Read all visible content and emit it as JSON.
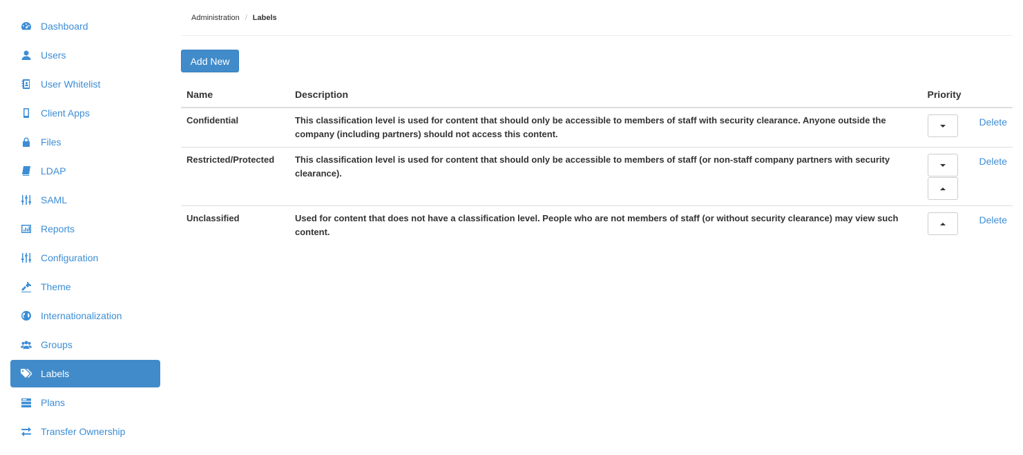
{
  "sidebar": {
    "items": [
      {
        "label": "Dashboard",
        "icon": "dashboard-icon"
      },
      {
        "label": "Users",
        "icon": "user-icon"
      },
      {
        "label": "User Whitelist",
        "icon": "address-book-icon"
      },
      {
        "label": "Client Apps",
        "icon": "mobile-icon"
      },
      {
        "label": "Files",
        "icon": "lock-icon"
      },
      {
        "label": "LDAP",
        "icon": "book-icon"
      },
      {
        "label": "SAML",
        "icon": "sliders-icon"
      },
      {
        "label": "Reports",
        "icon": "bar-chart-icon"
      },
      {
        "label": "Configuration",
        "icon": "sliders-icon"
      },
      {
        "label": "Theme",
        "icon": "theme-icon"
      },
      {
        "label": "Internationalization",
        "icon": "globe-icon"
      },
      {
        "label": "Groups",
        "icon": "group-icon"
      },
      {
        "label": "Labels",
        "icon": "tags-icon",
        "active": true
      },
      {
        "label": "Plans",
        "icon": "plans-icon"
      },
      {
        "label": "Transfer Ownership",
        "icon": "exchange-icon"
      }
    ]
  },
  "breadcrumb": {
    "parent": "Administration",
    "separator": "/",
    "current": "Labels"
  },
  "toolbar": {
    "add_new_label": "Add New"
  },
  "table": {
    "headers": {
      "name": "Name",
      "description": "Description",
      "priority": "Priority"
    },
    "rows": [
      {
        "name": "Confidential",
        "description": "This classification level is used for content that should only be accessible to members of staff with security clearance. Anyone outside the company (including partners) should not access this content.",
        "priority_buttons": [
          "down"
        ],
        "delete_label": "Delete"
      },
      {
        "name": "Restricted/Protected",
        "description": "This classification level is used for content that should only be accessible to members of staff (or non-staff company partners with security clearance).",
        "priority_buttons": [
          "down",
          "up"
        ],
        "delete_label": "Delete"
      },
      {
        "name": "Unclassified",
        "description": "Used for content that does not have a classification level. People who are not members of staff (or without security clearance) may view such content.",
        "priority_buttons": [
          "up"
        ],
        "delete_label": "Delete"
      }
    ]
  },
  "colors": {
    "accent": "#428bca",
    "link": "#3c8dd5",
    "text": "#333333",
    "border": "#dddddd"
  }
}
